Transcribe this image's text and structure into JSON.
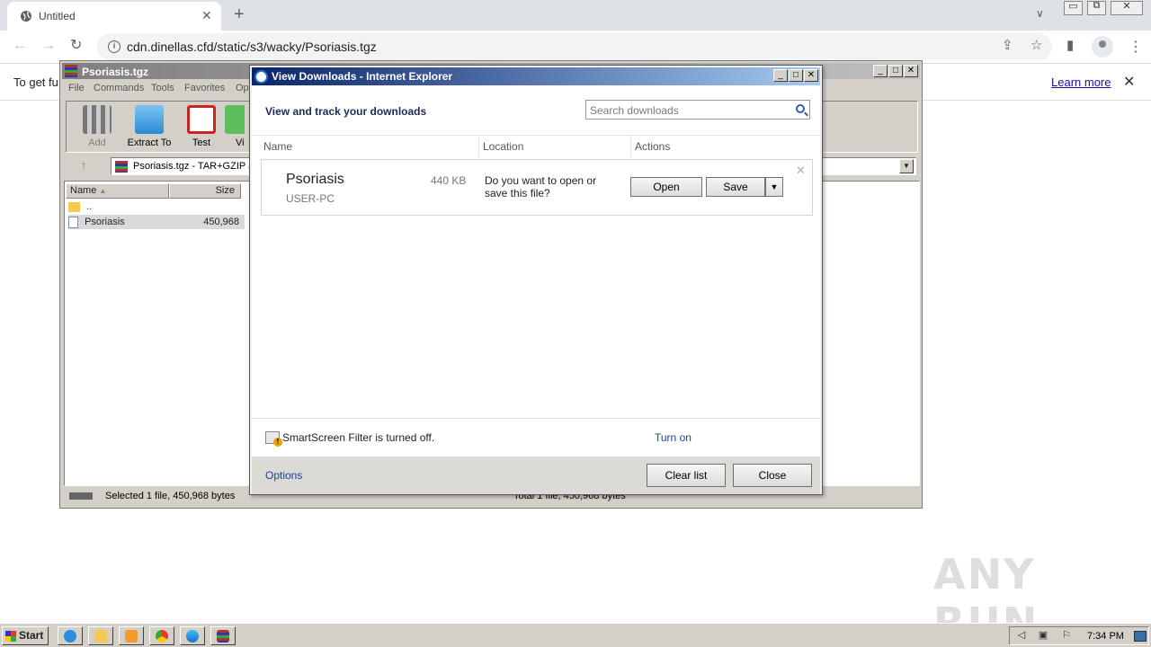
{
  "browser": {
    "tab_title": "Untitled",
    "url": "cdn.dinellas.cfd/static/s3/wacky/Psoriasis.tgz",
    "infobar_text": "To get fu",
    "infobar_link": "Learn more"
  },
  "winrar": {
    "title": "Psoriasis.tgz",
    "menu": [
      "File",
      "Commands",
      "Tools",
      "Favorites",
      "Op"
    ],
    "toolbar": [
      "Add",
      "Extract To",
      "Test",
      "Vi"
    ],
    "address": "Psoriasis.tgz - TAR+GZIP a",
    "columns": {
      "name": "Name",
      "size": "Size"
    },
    "rows": [
      {
        "name": "..",
        "size": ""
      },
      {
        "name": "Psoriasis",
        "size": "450,968"
      }
    ],
    "status_left": "Selected 1 file, 450,968 bytes",
    "status_right": "Total 1 file, 450,968 bytes"
  },
  "dialog": {
    "title": "View Downloads - Internet Explorer",
    "heading": "View and track your downloads",
    "search_placeholder": "Search downloads",
    "columns": {
      "name": "Name",
      "location": "Location",
      "actions": "Actions"
    },
    "item": {
      "name": "Psoriasis",
      "size": "440 KB",
      "host": "USER-PC",
      "question": "Do you want to open or save this file?",
      "open_label": "Open",
      "save_label": "Save"
    },
    "smartscreen_text": "SmartScreen Filter is turned off.",
    "turn_on": "Turn on",
    "options": "Options",
    "clear_list": "Clear list",
    "close": "Close"
  },
  "taskbar": {
    "start": "Start",
    "clock": "7:34 PM"
  },
  "watermark": "ANY RUN",
  "colors": {
    "ie_title_start": "#0a246a",
    "ie_title_end": "#a6caf0",
    "link": "#1c3f94",
    "classic_face": "#d4d0c8"
  }
}
